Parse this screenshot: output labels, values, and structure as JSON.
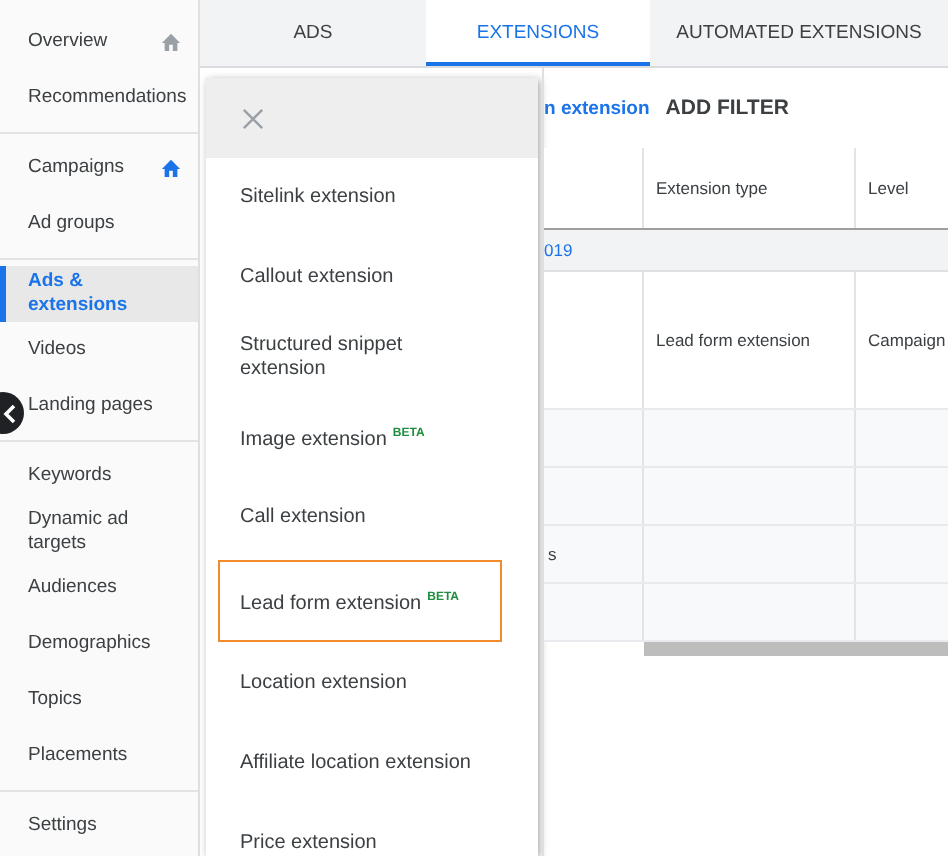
{
  "sidebar": {
    "groups": [
      [
        {
          "label": "Overview",
          "selected": false,
          "home_icon": true,
          "icon_highlighted": false
        },
        {
          "label": "Recommendations",
          "selected": false
        }
      ],
      [
        {
          "label": "Campaigns",
          "selected": false,
          "home_icon": true,
          "icon_highlighted": true
        },
        {
          "label": "Ad groups",
          "selected": false
        }
      ],
      [
        {
          "label": "Ads & extensions",
          "selected": true
        },
        {
          "label": "Videos",
          "selected": false
        },
        {
          "label": "Landing pages",
          "selected": false
        }
      ],
      [
        {
          "label": "Keywords",
          "selected": false
        },
        {
          "label": "Dynamic ad targets",
          "selected": false
        },
        {
          "label": "Audiences",
          "selected": false
        },
        {
          "label": "Demographics",
          "selected": false
        },
        {
          "label": "Topics",
          "selected": false
        },
        {
          "label": "Placements",
          "selected": false
        }
      ],
      [
        {
          "label": "Settings",
          "selected": false
        }
      ]
    ]
  },
  "tabs": [
    {
      "label": "ADS",
      "selected": false
    },
    {
      "label": "EXTENSIONS",
      "selected": true
    },
    {
      "label": "AUTOMATED EXTENSIONS",
      "selected": false
    }
  ],
  "toolbar": {
    "link": "n extension",
    "filter": "ADD FILTER"
  },
  "table": {
    "columns": [
      "Extension type",
      "Level"
    ],
    "group_row": "019",
    "rows": [
      {
        "extension_type": "Lead form extension",
        "level": "Campaign"
      },
      {},
      {},
      {
        "column_1": "s"
      },
      {}
    ]
  },
  "menu": {
    "items": [
      {
        "label": "Sitelink extension",
        "highlighted": false
      },
      {
        "label": "Callout extension",
        "highlighted": false
      },
      {
        "label": "Structured snippet extension",
        "highlighted": false
      },
      {
        "label": "Image extension",
        "badge": "BETA",
        "highlighted": false
      },
      {
        "label": "Call extension",
        "highlighted": false
      },
      {
        "label": "Lead form extension",
        "badge": "BETA",
        "highlighted": true
      },
      {
        "label": "Location extension",
        "highlighted": false
      },
      {
        "label": "Affiliate location extension",
        "highlighted": false
      },
      {
        "label": "Price extension",
        "highlighted": false
      }
    ]
  }
}
